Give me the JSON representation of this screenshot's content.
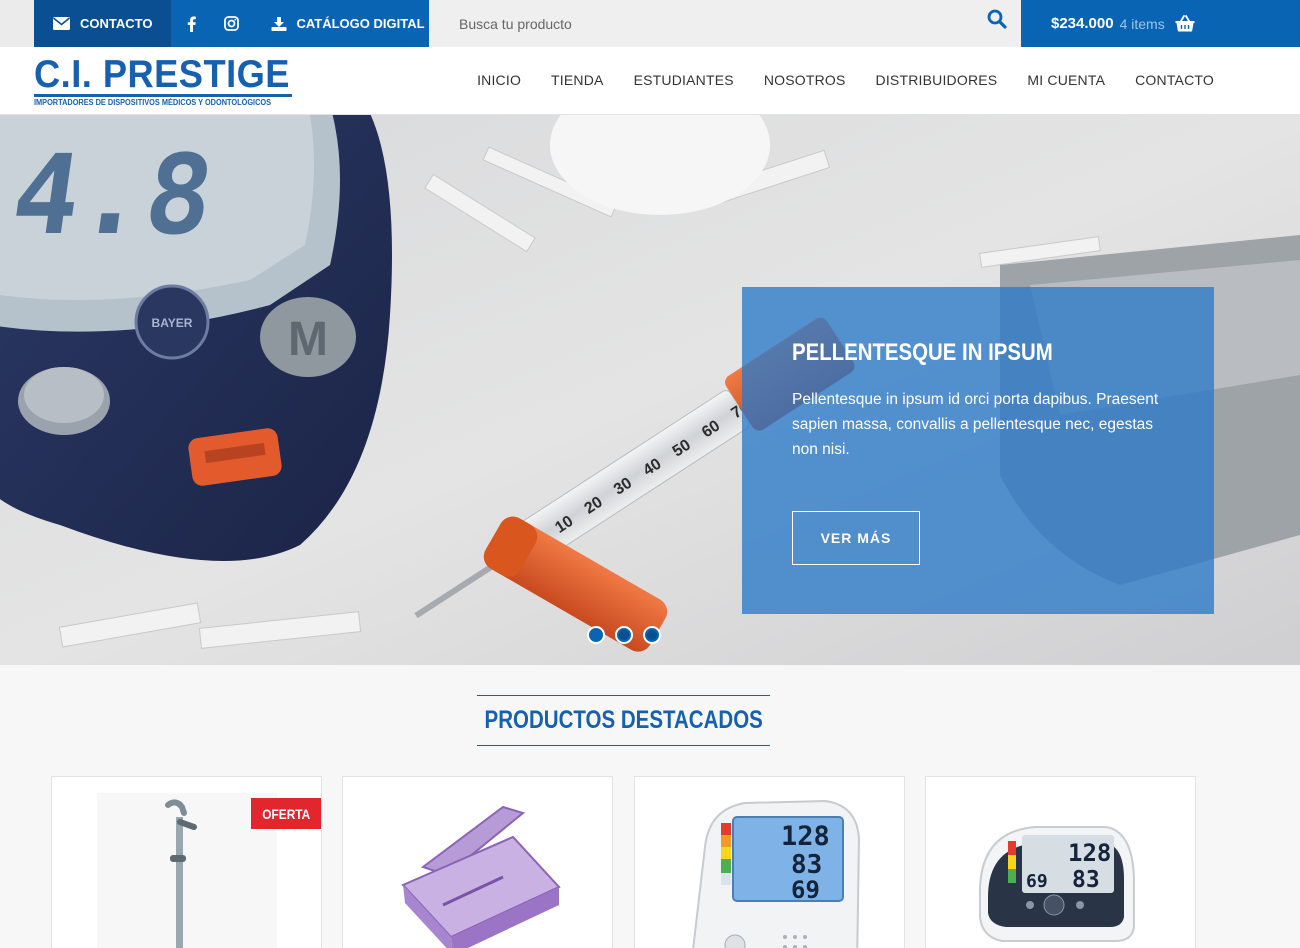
{
  "topbar": {
    "contact_label": "CONTACTO",
    "catalog_label": "CATÁLOGO DIGITAL",
    "search_placeholder": "Busca tu producto",
    "cart_total": "$234.000",
    "cart_items": "4 items"
  },
  "header": {
    "logo_title": "C.I. PRESTIGE",
    "logo_subtitle": "IMPORTADORES DE DISPOSITIVOS MÉDICOS Y ODONTOLÓGICOS",
    "nav": [
      "INICIO",
      "TIENDA",
      "ESTUDIANTES",
      "NOSOTROS",
      "DISTRIBUIDORES",
      "MI CUENTA",
      "CONTACTO"
    ]
  },
  "hero": {
    "title": "PELLENTESQUE IN IPSUM",
    "text": "Pellentesque in ipsum id orci porta dapibus. Praesent sapien massa, convallis a pellentesque nec, egestas non nisi.",
    "button": "VER MÁS",
    "meter_reading": "4.8",
    "syringe_marks": [
      "10",
      "20",
      "30",
      "40",
      "50",
      "60",
      "70"
    ],
    "slides": 3,
    "active_slide": 1
  },
  "featured": {
    "title": "PRODUCTOS DESTACADOS",
    "products": [
      {
        "badge": "OFERTA",
        "image": "crutch"
      },
      {
        "badge": "",
        "image": "pill-splitter"
      },
      {
        "badge": "",
        "image": "blood-pressure-monitor",
        "display": [
          "128",
          "83",
          "69"
        ]
      },
      {
        "badge": "",
        "image": "wrist-blood-pressure-monitor",
        "display": [
          "128",
          "83",
          "69"
        ]
      }
    ]
  },
  "colors": {
    "primary": "#0a64b4",
    "primary_dark": "#0a4f91",
    "offer_red": "#e1262d"
  }
}
